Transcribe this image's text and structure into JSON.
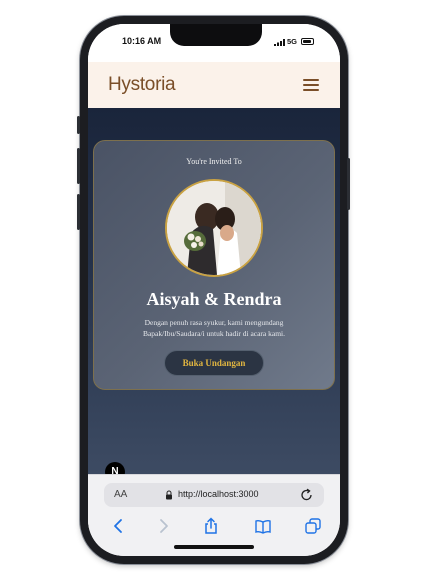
{
  "status": {
    "time": "10:16 AM",
    "network": "5G"
  },
  "header": {
    "brand": "Hystoria"
  },
  "invitation": {
    "label": "You're Invited To",
    "couple": "Aisyah & Rendra",
    "message": "Dengan penuh rasa syukur, kami mengundang Bapak/Ibu/Saudara/i untuk hadir di acara kami.",
    "button_label": "Buka Undangan"
  },
  "badge": {
    "letter": "N"
  },
  "browser": {
    "aa_label": "AA",
    "url": "http://localhost:3000"
  },
  "colors": {
    "brand": "#7a4e28",
    "header_bg": "#fbf2ea",
    "accent_gold": "#e2b640",
    "ios_blue": "#1f73e6"
  },
  "icons": [
    "menu-icon",
    "lock-icon",
    "reload-icon",
    "back-icon",
    "forward-icon",
    "share-icon",
    "bookmarks-icon",
    "tabs-icon",
    "nextjs-icon"
  ]
}
